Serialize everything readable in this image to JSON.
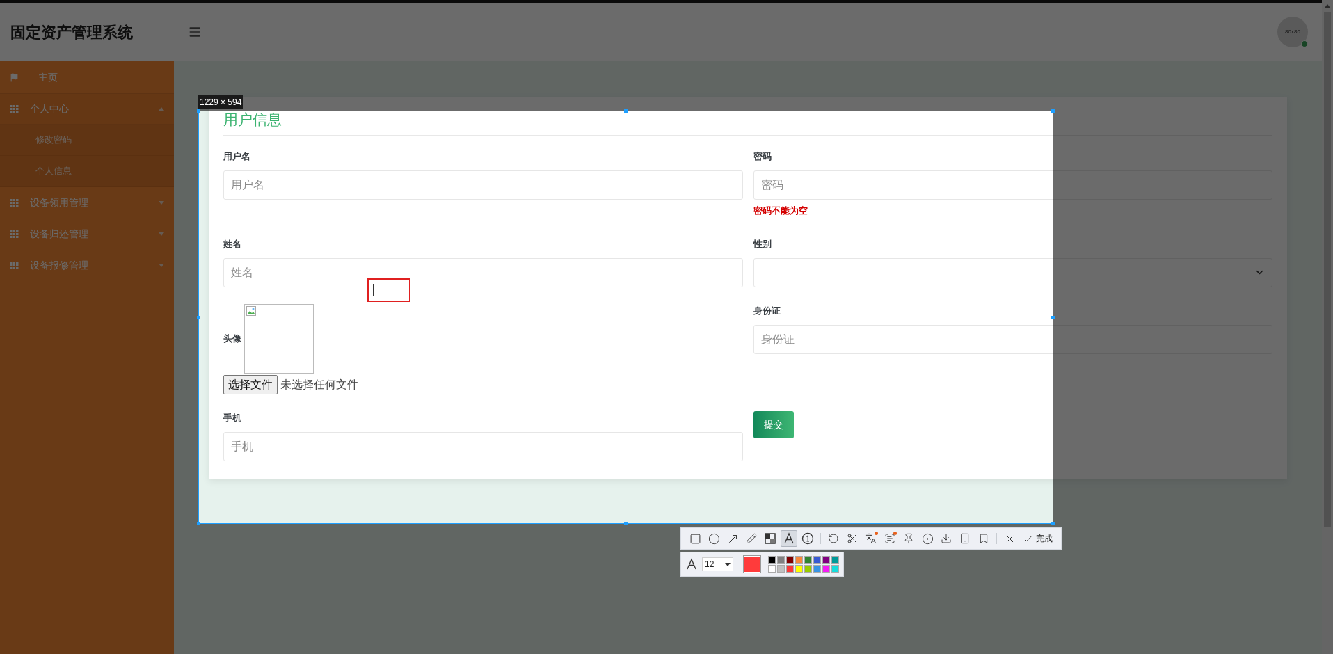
{
  "app": {
    "title": "固定资产管理系统"
  },
  "header": {
    "avatar": {
      "label": "80x80",
      "online": true
    }
  },
  "sidebar": {
    "items": [
      {
        "kind": "home",
        "label": "主页"
      },
      {
        "kind": "group",
        "label": "个人中心",
        "expanded": true,
        "children": [
          {
            "label": "修改密码"
          },
          {
            "label": "个人信息"
          }
        ]
      },
      {
        "kind": "group",
        "label": "设备领用管理",
        "expanded": false
      },
      {
        "kind": "group",
        "label": "设备归还管理",
        "expanded": false
      },
      {
        "kind": "group",
        "label": "设备报修管理",
        "expanded": false
      }
    ]
  },
  "form": {
    "title": "用户信息",
    "fields": [
      {
        "kind": "input",
        "label": "用户名",
        "placeholder": "用户名"
      },
      {
        "kind": "input",
        "label": "密码",
        "placeholder": "密码",
        "error": "密码不能为空"
      },
      {
        "kind": "input",
        "label": "姓名",
        "placeholder": "姓名"
      },
      {
        "kind": "select",
        "label": "性别"
      },
      {
        "kind": "file",
        "label": "头像",
        "button": "选择文件",
        "status": "未选择任何文件"
      },
      {
        "kind": "input",
        "label": "身份证",
        "placeholder": "身份证"
      },
      {
        "kind": "input",
        "label": "手机",
        "placeholder": "手机"
      },
      {
        "kind": "submit",
        "label": "提交"
      }
    ]
  },
  "capture": {
    "size": "1229 × 594",
    "tools": [
      {
        "kind": "rectangle",
        "selected": false
      },
      {
        "kind": "ellipse",
        "selected": false
      },
      {
        "kind": "arrow",
        "selected": false
      },
      {
        "kind": "pencil",
        "selected": false
      },
      {
        "kind": "mosaic",
        "selected": false
      },
      {
        "kind": "text",
        "selected": true
      },
      {
        "kind": "number",
        "selected": false
      },
      {
        "kind": "separator"
      },
      {
        "kind": "undo",
        "selected": false
      },
      {
        "kind": "cut",
        "selected": false
      },
      {
        "kind": "translate",
        "selected": false,
        "badge": true
      },
      {
        "kind": "ocr",
        "selected": false,
        "badge": true
      },
      {
        "kind": "pin",
        "selected": false
      },
      {
        "kind": "record",
        "selected": false
      },
      {
        "kind": "download",
        "selected": false
      },
      {
        "kind": "phone",
        "selected": false
      },
      {
        "kind": "bookmark",
        "selected": false
      },
      {
        "kind": "separator"
      },
      {
        "kind": "close",
        "selected": false
      },
      {
        "kind": "done",
        "selected": false,
        "label": "完成"
      }
    ],
    "font_size": "12",
    "current": {
      "color": "#ff3b3b"
    },
    "palette": [
      {
        "color": "#000000"
      },
      {
        "color": "#808080"
      },
      {
        "color": "#800000"
      },
      {
        "color": "#f7883a"
      },
      {
        "color": "#308430"
      },
      {
        "color": "#385ad3"
      },
      {
        "color": "#800080"
      },
      {
        "color": "#009999"
      },
      {
        "color": "#ffffff"
      },
      {
        "color": "#c0c0c0"
      },
      {
        "color": "#fb3838"
      },
      {
        "color": "#ffff00"
      },
      {
        "color": "#99cc00"
      },
      {
        "color": "#3894e4"
      },
      {
        "color": "#f31bf3"
      },
      {
        "color": "#16dcdc"
      }
    ]
  }
}
